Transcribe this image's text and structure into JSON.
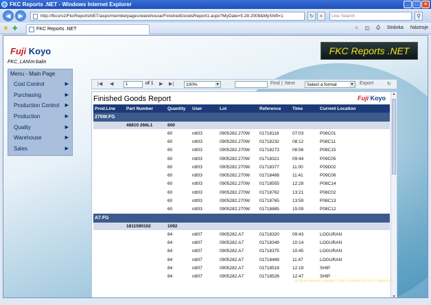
{
  "window": {
    "title": "FKC Reports .NET - Windows Internet Explorer"
  },
  "browser": {
    "address": "http://fkcsrv2/FkcReportsNET/aspx/memberpages/warehouse/FinishedGoodsReport1.aspx?MyDate=5.28.2009&MyShift=1",
    "search_placeholder": "Live Search",
    "tab_title": "FKC Reports .NET",
    "tools": [
      "Stránka",
      "Nástroje"
    ]
  },
  "header": {
    "logo_fuji": "Fuji",
    "logo_koyo": "Koyo",
    "user": "FKC_LAN\\m-balin",
    "banner": "FKC Reports .NET"
  },
  "menu": {
    "title": "Menu - Main Page",
    "items": [
      {
        "label": "Cost Control"
      },
      {
        "label": "Purchasing"
      },
      {
        "label": "Production Control"
      },
      {
        "label": "Production"
      },
      {
        "label": "Quality"
      },
      {
        "label": "Warehouse"
      },
      {
        "label": "Sales"
      }
    ]
  },
  "report_toolbar": {
    "page_value": "1",
    "page_of": "of 1",
    "zoom": "100%",
    "find": "Find",
    "next": "Next",
    "format": "Select a format",
    "export": "Export"
  },
  "report": {
    "title": "Finished Goods Report",
    "columns": [
      "Prod.Line",
      "Part Number",
      "Quantity",
      "User",
      "Lot",
      "Reference",
      "Time",
      "Current Location"
    ],
    "groups": [
      {
        "line": "270W.FG",
        "part": "48810 266L1",
        "qty": "600",
        "rows": [
          [
            "60",
            "rdt03",
            "0905282.270W",
            "01718118",
            "07:03",
            "P08C01"
          ],
          [
            "60",
            "rdt03",
            "0905282.270W",
            "01718232",
            "08:12",
            "P08C11"
          ],
          [
            "60",
            "rdt03",
            "0905282.270W",
            "01718273",
            "08:56",
            "P08C15"
          ],
          [
            "60",
            "rdt03",
            "0905282.270W",
            "01718321",
            "09:44",
            "P09C05"
          ],
          [
            "60",
            "rdt03",
            "0905282.270W",
            "01718377",
            "11:00",
            "P09D02"
          ],
          [
            "60",
            "rdt03",
            "0905282.270W",
            "01718488",
            "11:41",
            "P09C06"
          ],
          [
            "60",
            "rdt03",
            "0905282.270W",
            "01718555",
            "12:28",
            "P08C14"
          ],
          [
            "60",
            "rdt03",
            "0905282.270W",
            "01718762",
            "13:21",
            "P08C02"
          ],
          [
            "60",
            "rdt03",
            "0905282.270W",
            "01718765",
            "13:59",
            "P08C13"
          ],
          [
            "60",
            "rdt03",
            "0905282.270W",
            "01718885",
            "15:09",
            "P08C12"
          ]
        ]
      },
      {
        "line": "A7.FG",
        "part": "1811590102",
        "qty": "1092",
        "rows": [
          [
            "84",
            "rdt07",
            "0905282.A7",
            "01718320",
            "09:43",
            "LOGURAN"
          ],
          [
            "84",
            "rdt07",
            "0905282.A7",
            "01718349",
            "10:14",
            "LOGURAN"
          ],
          [
            "84",
            "rdt07",
            "0905282.A7",
            "01718375",
            "10:45",
            "LOGURAN"
          ],
          [
            "84",
            "rdt07",
            "0905282.A7",
            "01718489",
            "11:47",
            "LOGURAN"
          ],
          [
            "84",
            "rdt07",
            "0905282.A7",
            "01718518",
            "12:19",
            "SHIP"
          ],
          [
            "84",
            "rdt07",
            "0905282.A7",
            "01718526",
            "12:47",
            "SHIP"
          ]
        ]
      }
    ]
  },
  "footer": "All rights reserved. Copyright © 2009, Developed by FKC IT Department.",
  "colors": {
    "header_bar": "#1c3a78",
    "group_bar": "#3d5a8c",
    "banner_text": "#f0e020"
  }
}
